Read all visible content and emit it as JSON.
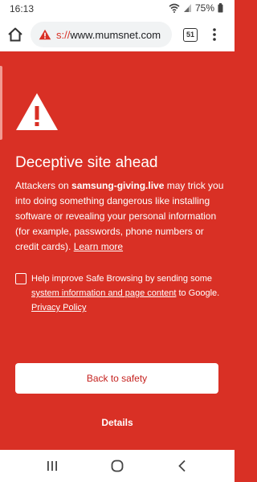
{
  "status_bar": {
    "time": "16:13",
    "battery": "75%",
    "icons": [
      "wifi-icon",
      "signal-icon",
      "battery-icon"
    ]
  },
  "browser": {
    "url_scheme": "s://",
    "url_host": "www.mumsnet.com",
    "tab_count": "51",
    "icons": [
      "home-icon",
      "warning-icon",
      "menu-icon"
    ]
  },
  "interstitial": {
    "title": "Deceptive site ahead",
    "body_prefix": "Attackers on ",
    "body_site": "samsung-giving.live",
    "body_suffix": " may trick you into doing something dangerous like installing software or revealing your personal information (for example, passwords, phone numbers or credit cards). ",
    "learn_more": "Learn more",
    "checkbox_prefix": "Help improve Safe Browsing by sending some ",
    "checkbox_link": "system information and page content",
    "checkbox_suffix": " to Google. ",
    "privacy_link": "Privacy Policy",
    "checkbox_checked": false,
    "back_button": "Back to safety",
    "details_button": "Details",
    "colors": {
      "background": "#d93025",
      "button_text": "#c5221f"
    }
  },
  "navigation_bar": {
    "icons": [
      "recent-apps-icon",
      "home-circle-icon",
      "back-icon"
    ]
  }
}
